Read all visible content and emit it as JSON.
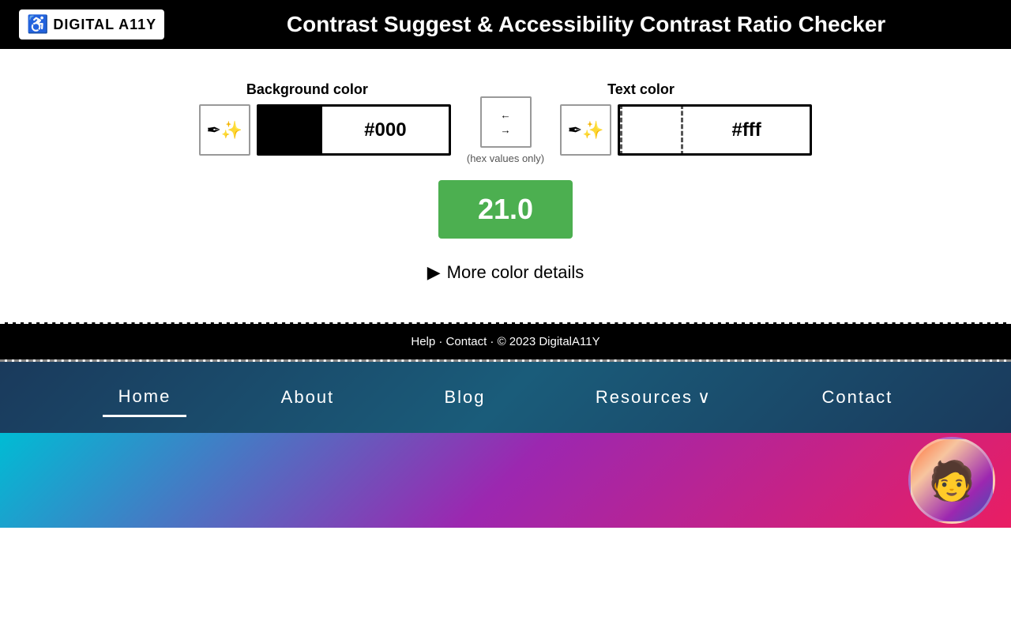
{
  "header": {
    "logo_text": "DIGITAL A11Y",
    "title": "Contrast Suggest & Accessibility Contrast Ratio Checker"
  },
  "tool": {
    "background_color_label": "Background color",
    "text_color_label": "Text color",
    "bg_hex_value": "#000",
    "text_hex_value": "#fff",
    "bg_swatch_color": "#000000",
    "text_swatch_color": "#ffffff",
    "swap_label": "(hex values only)",
    "contrast_ratio": "21.0",
    "more_details_label": "More color details",
    "eyedropper_icon": "✒",
    "arrow_swap_up": "←",
    "arrow_swap_down": "→"
  },
  "footer": {
    "links": "Help · Contact · © 2023 DigitalA11Y"
  },
  "nav": {
    "items": [
      {
        "label": "Home",
        "active": true
      },
      {
        "label": "About",
        "active": false
      },
      {
        "label": "Blog",
        "active": false
      },
      {
        "label": "Resources",
        "active": false,
        "has_dropdown": true
      },
      {
        "label": "Contact",
        "active": false
      }
    ]
  },
  "hero": {
    "avatar_emoji": "🧑"
  }
}
